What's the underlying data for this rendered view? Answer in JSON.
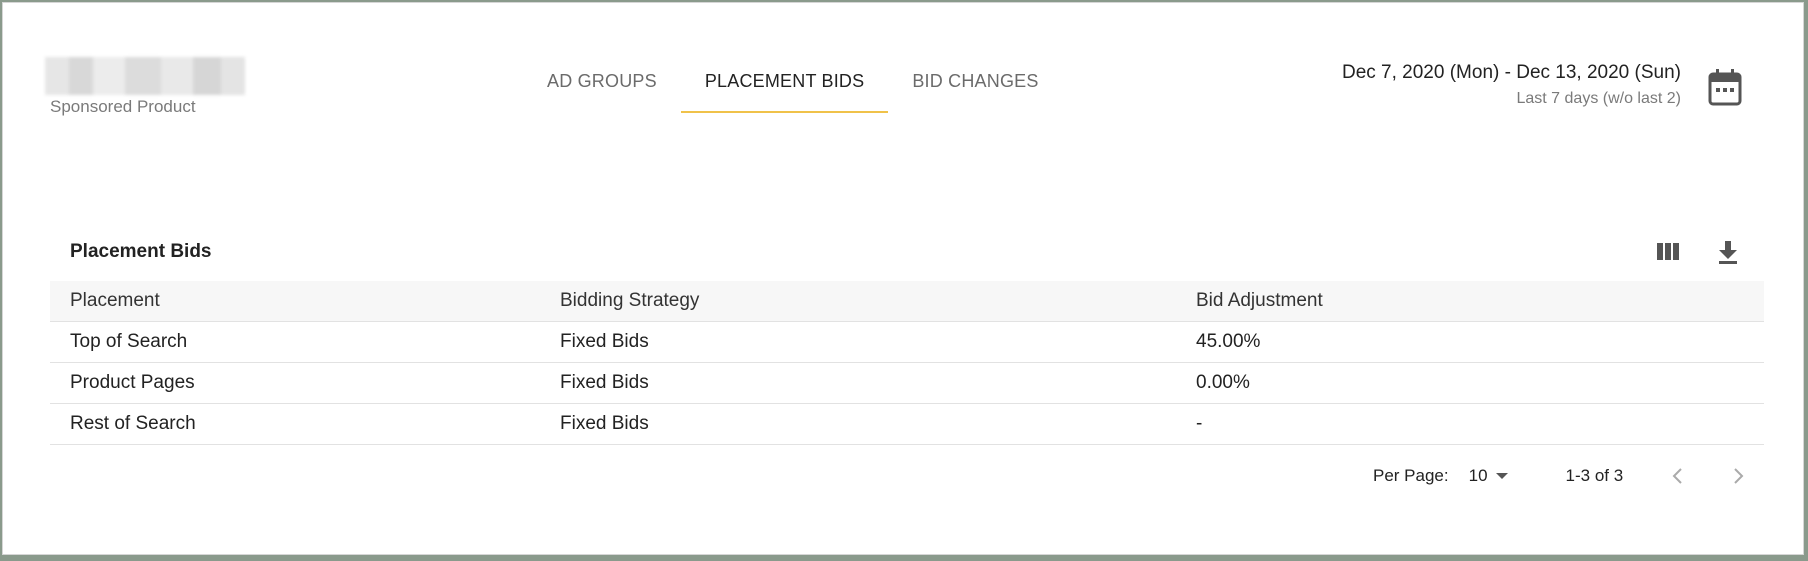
{
  "header": {
    "account_subtitle": "Sponsored Product",
    "tabs": [
      {
        "label": "AD GROUPS",
        "active": false
      },
      {
        "label": "PLACEMENT BIDS",
        "active": true
      },
      {
        "label": "BID CHANGES",
        "active": false
      }
    ],
    "date_range": "Dec 7, 2020 (Mon) - Dec 13, 2020 (Sun)",
    "date_preset": "Last 7 days (w/o last 2)",
    "accent_color": "#f0c24a"
  },
  "section": {
    "title": "Placement Bids",
    "tools": [
      "columns-icon",
      "download-icon"
    ]
  },
  "table": {
    "columns": [
      "Placement",
      "Bidding Strategy",
      "Bid Adjustment"
    ],
    "rows": [
      [
        "Top of Search",
        "Fixed Bids",
        "45.00%"
      ],
      [
        "Product Pages",
        "Fixed Bids",
        "0.00%"
      ],
      [
        "Rest of Search",
        "Fixed Bids",
        "-"
      ]
    ]
  },
  "pagination": {
    "per_page_label": "Per Page:",
    "per_page_value": "10",
    "range_text": "1-3 of 3"
  }
}
